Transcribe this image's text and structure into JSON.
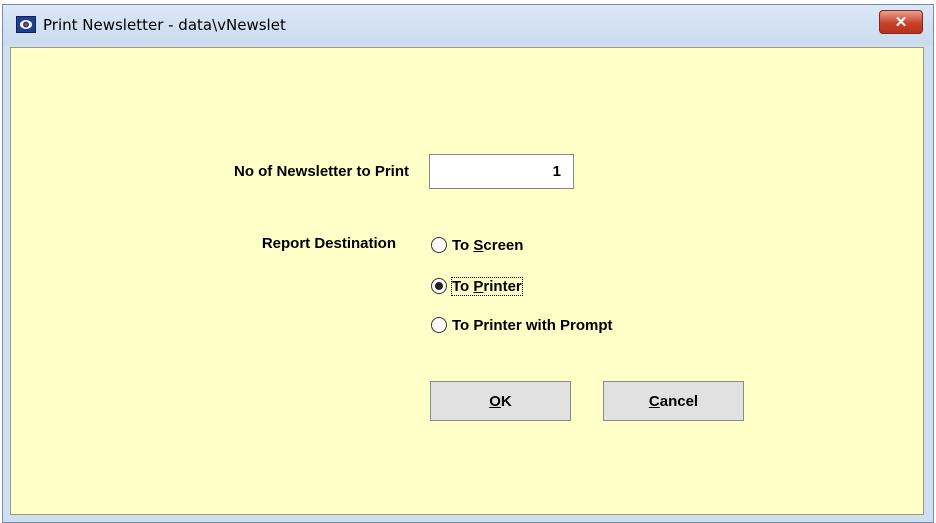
{
  "window": {
    "title": "Print Newsletter - data\\vNewslet",
    "close_label": "✕"
  },
  "form": {
    "copies_label": "No of Newsletter to Print",
    "copies_value": "1",
    "destination_label": "Report Destination",
    "options": [
      {
        "prefix": "To ",
        "accel": "S",
        "rest": "creen",
        "checked": false
      },
      {
        "prefix": "To ",
        "accel": "P",
        "rest": "rinter",
        "checked": true
      },
      {
        "prefix": "To Printer with Prompt",
        "accel": "",
        "rest": "",
        "checked": false
      }
    ]
  },
  "buttons": {
    "ok": {
      "accel": "O",
      "rest": "K"
    },
    "cancel": {
      "accel": "C",
      "rest": "ancel"
    }
  },
  "colors": {
    "client_bg": "#ffffc8",
    "title_bg": "#cfe0f1",
    "close_red": "#c8432a"
  },
  "icons": {
    "title": "app-icon",
    "close": "close-icon"
  }
}
